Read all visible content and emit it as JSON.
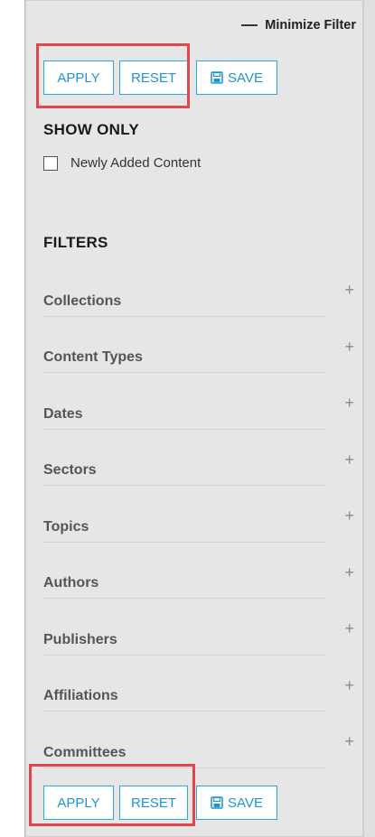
{
  "header": {
    "minimize_label": "Minimize Filter"
  },
  "top_actions": {
    "apply": "APPLY",
    "reset": "RESET",
    "save": "SAVE"
  },
  "show_only": {
    "title": "SHOW ONLY",
    "options": [
      {
        "label": "Newly Added Content",
        "checked": false
      }
    ]
  },
  "filters": {
    "title": "FILTERS",
    "items": [
      {
        "label": "Collections"
      },
      {
        "label": "Content Types"
      },
      {
        "label": "Dates"
      },
      {
        "label": "Sectors"
      },
      {
        "label": "Topics"
      },
      {
        "label": "Authors"
      },
      {
        "label": "Publishers"
      },
      {
        "label": "Affiliations"
      },
      {
        "label": "Committees"
      }
    ]
  },
  "bottom_actions": {
    "apply": "APPLY",
    "reset": "RESET",
    "save": "SAVE"
  },
  "icons": {
    "expand": "plus-icon",
    "save": "floppy-disk-icon",
    "minimize": "minus-icon"
  },
  "colors": {
    "accent": "#2fa7de",
    "highlight": "#e0474c",
    "panel": "#e6e6e6"
  }
}
